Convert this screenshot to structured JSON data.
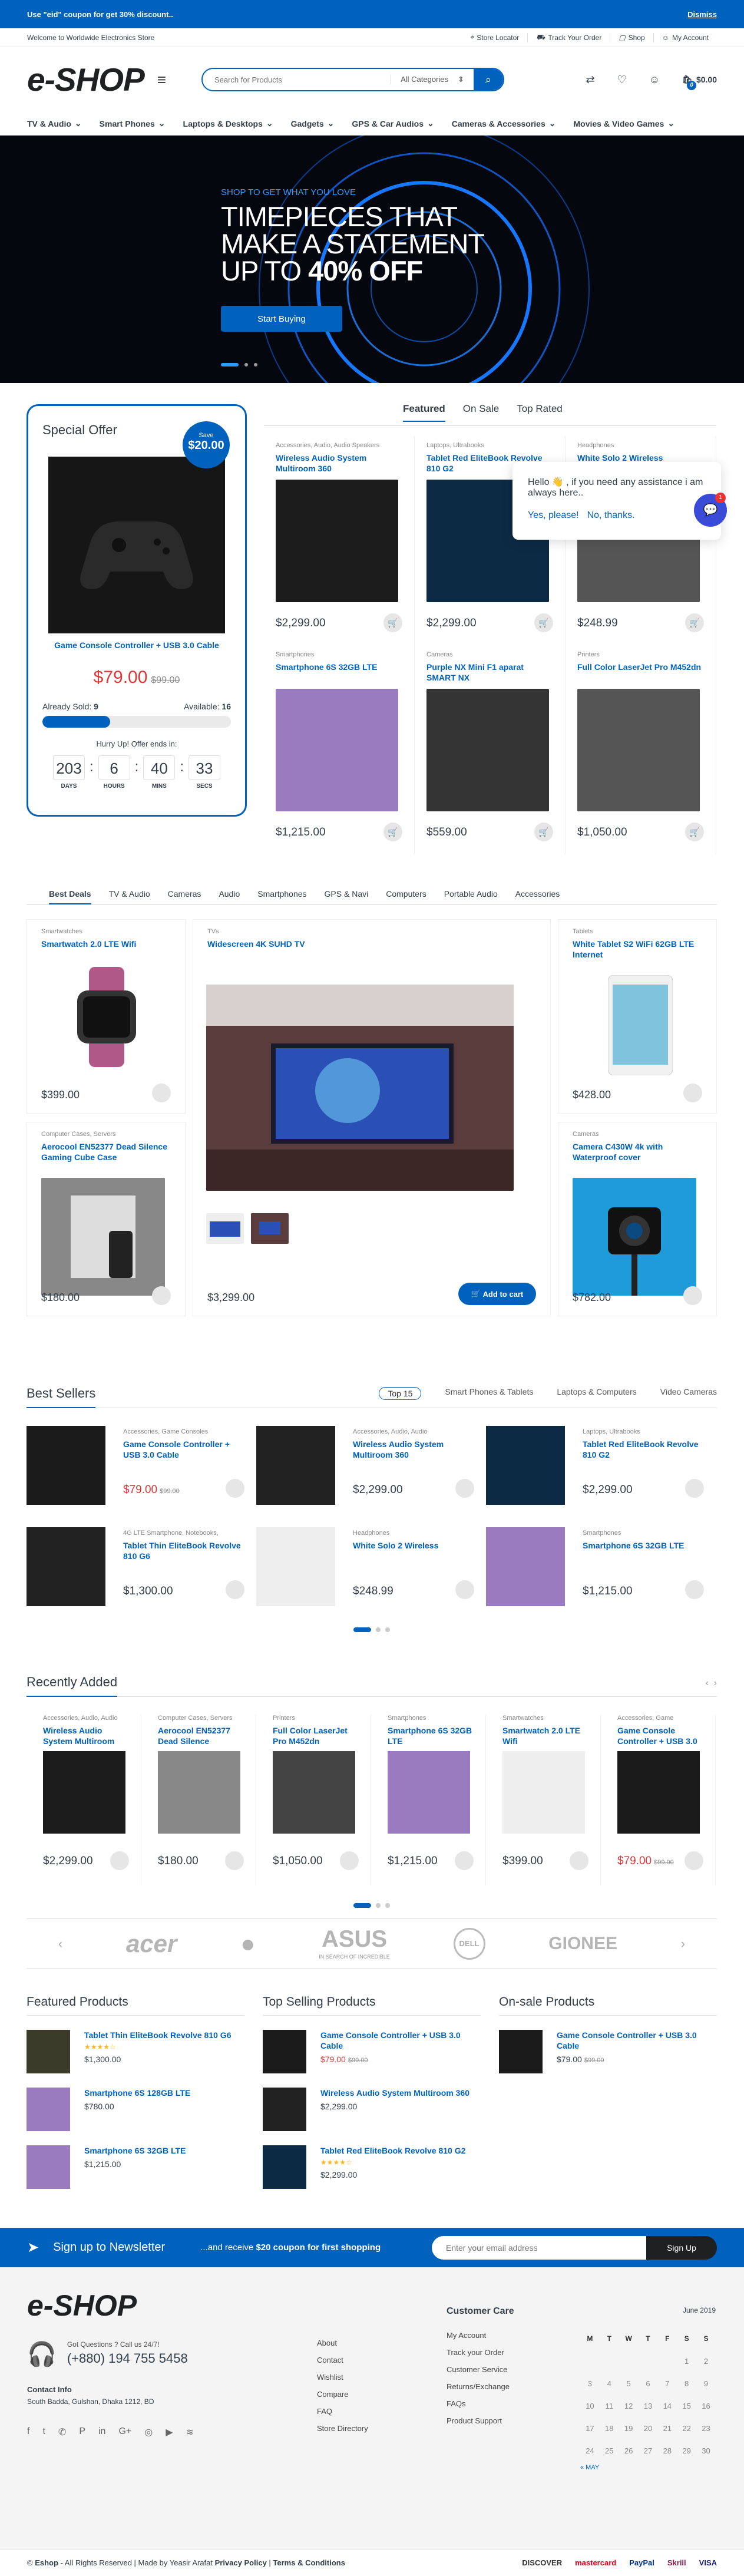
{
  "promo": {
    "text": "Use \"eid\" coupon for get 30% discount..",
    "dismiss": "Dismiss"
  },
  "topbar": {
    "welcome": "Welcome to Worldwide Electronics Store",
    "links": [
      "Store Locator",
      "Track Your Order",
      "Shop",
      "My Account"
    ]
  },
  "header": {
    "logo": "e-SHOP",
    "search_placeholder": "Search for Products",
    "category": "All Categories",
    "cart_total": "$0.00",
    "cart_count": "0"
  },
  "nav": [
    "TV & Audio",
    "Smart Phones",
    "Laptops & Desktops",
    "Gadgets",
    "GPS & Car Audios",
    "Cameras & Accessories",
    "Movies & Video Games"
  ],
  "hero": {
    "pre": "SHOP TO GET WHAT YOU LOVE",
    "line1": "TIMEPIECES THAT",
    "line2": "MAKE A STATEMENT",
    "line3a": "UP TO",
    "line3b": "40% OFF",
    "button": "Start Buying"
  },
  "special": {
    "title": "Special Offer",
    "save_label": "Save",
    "save_amount": "$20.00",
    "product": "Game Console Controller + USB 3.0 Cable",
    "price": "$79.00",
    "old_price": "$99.00",
    "sold_label": "Already Sold:",
    "sold": "9",
    "avail_label": "Available:",
    "avail": "16",
    "sold_fraction": 0.36,
    "hurry": "Hurry Up! Offer ends in:",
    "timer": [
      {
        "v": "203",
        "l": "DAYS"
      },
      {
        "v": "6",
        "l": "HOURS"
      },
      {
        "v": "40",
        "l": "MINS"
      },
      {
        "v": "33",
        "l": "SECS"
      }
    ]
  },
  "featured_tabs": [
    "Featured",
    "On Sale",
    "Top Rated"
  ],
  "featured": [
    {
      "cat": "Accessories, Audio, Audio Speakers",
      "name": "Wireless Audio System Multiroom 360",
      "price": "$2,299.00"
    },
    {
      "cat": "Laptops, Ultrabooks",
      "name": "Tablet Red EliteBook Revolve 810 G2",
      "price": "$2,299.00"
    },
    {
      "cat": "Headphones",
      "name": "White Solo 2 Wireless",
      "price": "$248.99"
    },
    {
      "cat": "Smartphones",
      "name": "Smartphone 6S 32GB LTE",
      "price": "$1,215.00"
    },
    {
      "cat": "Cameras",
      "name": "Purple NX Mini F1 aparat SMART NX",
      "price": "$559.00"
    },
    {
      "cat": "Printers",
      "name": "Full Color LaserJet Pro M452dn",
      "price": "$1,050.00"
    }
  ],
  "chat": {
    "msg": "Hello 👋 , if you need any assistance i am always here..",
    "yes": "Yes, please!",
    "no": "No, thanks.",
    "badge": "1"
  },
  "deals_tabs": [
    "Best Deals",
    "TV & Audio",
    "Cameras",
    "Audio",
    "Smartphones",
    "GPS & Navi",
    "Computers",
    "Portable Audio",
    "Accessories"
  ],
  "deals": {
    "left1": {
      "cat": "Smartwatches",
      "name": "Smartwatch 2.0 LTE Wifi",
      "price": "$399.00"
    },
    "left2": {
      "cat": "Computer Cases, Servers",
      "name": "Aerocool EN52377 Dead Silence Gaming Cube Case",
      "price": "$180.00"
    },
    "center": {
      "cat": "TVs",
      "name": "Widescreen 4K SUHD TV",
      "price": "$3,299.00",
      "button": "Add to cart"
    },
    "right1": {
      "cat": "Tablets",
      "name": "White Tablet S2 WiFi 62GB LTE Internet",
      "price": "$428.00"
    },
    "right2": {
      "cat": "Cameras",
      "name": "Camera C430W 4k with Waterproof cover",
      "price": "$782.00"
    }
  },
  "bestsellers": {
    "title": "Best Sellers",
    "tabs": [
      "Top 15",
      "Smart Phones & Tablets",
      "Laptops & Computers",
      "Video Cameras"
    ],
    "items": [
      {
        "cat": "Accessories, Game Consoles",
        "name": "Game Console Controller + USB 3.0 Cable",
        "price": "$79.00",
        "old": "$99.00",
        "sale": true
      },
      {
        "cat": "Accessories, Audio, Audio",
        "name": "Wireless Audio System Multiroom 360",
        "price": "$2,299.00"
      },
      {
        "cat": "Laptops, Ultrabooks",
        "name": "Tablet Red EliteBook Revolve 810 G2",
        "price": "$2,299.00"
      },
      {
        "cat": "4G LTE Smartphone, Notebooks,",
        "name": "Tablet Thin EliteBook Revolve 810 G6",
        "price": "$1,300.00"
      },
      {
        "cat": "Headphones",
        "name": "White Solo 2 Wireless",
        "price": "$248.99"
      },
      {
        "cat": "Smartphones",
        "name": "Smartphone 6S 32GB LTE",
        "price": "$1,215.00"
      }
    ]
  },
  "recent": {
    "title": "Recently Added",
    "items": [
      {
        "cat": "Accessories, Audio, Audio",
        "name": "Wireless Audio System Multiroom",
        "price": "$2,299.00"
      },
      {
        "cat": "Computer Cases, Servers",
        "name": "Aerocool EN52377 Dead Silence",
        "price": "$180.00"
      },
      {
        "cat": "Printers",
        "name": "Full Color LaserJet Pro M452dn",
        "price": "$1,050.00"
      },
      {
        "cat": "Smartphones",
        "name": "Smartphone 6S 32GB LTE",
        "price": "$1,215.00"
      },
      {
        "cat": "Smartwatches",
        "name": "Smartwatch 2.0 LTE Wifi",
        "price": "$399.00"
      },
      {
        "cat": "Accessories, Game",
        "name": "Game Console Controller + USB 3.0",
        "price": "$79.00",
        "old": "$99.00",
        "sale": true
      }
    ]
  },
  "brands": [
    "acer",
    "",
    "ASUS",
    "DELL",
    "GIONEE"
  ],
  "brand_sub": "IN SEARCH OF INCREDIBLE",
  "cols": [
    {
      "title": "Featured Products",
      "items": [
        {
          "name": "Tablet Thin EliteBook Revolve 810 G6",
          "price": "$1,300.00",
          "stars": "★★★★☆"
        },
        {
          "name": "Smartphone 6S 128GB LTE",
          "price": "$780.00"
        },
        {
          "name": "Smartphone 6S 32GB LTE",
          "price": "$1,215.00"
        }
      ]
    },
    {
      "title": "Top Selling Products",
      "items": [
        {
          "name": "Game Console Controller + USB 3.0 Cable",
          "price": "$79.00",
          "old": "$99.00",
          "sale": true
        },
        {
          "name": "Wireless Audio System Multiroom 360",
          "price": "$2,299.00"
        },
        {
          "name": "Tablet Red EliteBook Revolve 810 G2",
          "price": "$2,299.00",
          "stars": "★★★★☆"
        }
      ]
    },
    {
      "title": "On-sale Products",
      "items": [
        {
          "name": "Game Console Controller + USB 3.0 Cable",
          "price": "$79.00",
          "old": "$99.00"
        }
      ]
    }
  ],
  "newsletter": {
    "title": "Sign up to Newsletter",
    "sub_pre": "...and receive ",
    "sub_bold": "$20 coupon for first shopping",
    "placeholder": "Enter your email address",
    "button": "Sign Up"
  },
  "footer": {
    "logo": "e-SHOP",
    "question": "Got Questions ? Call us 24/7!",
    "phone": "(+880) 194 755 5458",
    "contact_title": "Contact Info",
    "address": "South Badda, Gulshan, Dhaka 1212, BD",
    "links1": [
      "About",
      "Contact",
      "Wishlist",
      "Compare",
      "FAQ",
      "Store Directory"
    ],
    "care_title": "Customer Care",
    "links2": [
      "My Account",
      "Track your Order",
      "Customer Service",
      "Returns/Exchange",
      "FAQs",
      "Product Support"
    ],
    "cal_month": "June 2019",
    "cal_days": [
      "M",
      "T",
      "W",
      "T",
      "F",
      "S",
      "S"
    ],
    "cal_rows": [
      [
        "",
        "",
        "",
        "",
        "",
        "1",
        "2"
      ],
      [
        "3",
        "4",
        "5",
        "6",
        "7",
        "8",
        "9"
      ],
      [
        "10",
        "11",
        "12",
        "13",
        "14",
        "15",
        "16"
      ],
      [
        "17",
        "18",
        "19",
        "20",
        "21",
        "22",
        "23"
      ],
      [
        "24",
        "25",
        "26",
        "27",
        "28",
        "29",
        "30"
      ]
    ],
    "cal_prev": "« MAY"
  },
  "copyright": {
    "brand": "Eshop",
    "text": " - All Rights Reserved | Made by Yeasir Arafat ",
    "privacy": "Privacy Policy",
    "terms": "Terms & Conditions",
    "payments": [
      "DISCOVER",
      "mastercard",
      "PayPal",
      "Skrill",
      "VISA"
    ]
  }
}
